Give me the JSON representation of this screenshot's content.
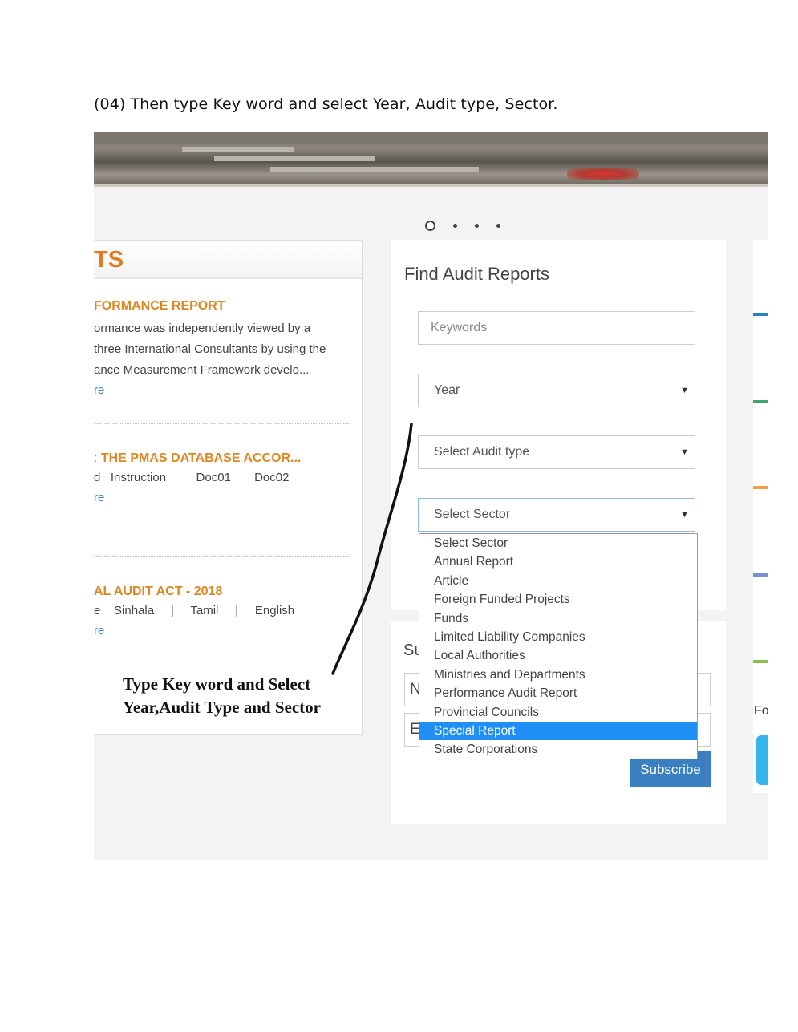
{
  "instruction": "(04) Then type Key word and select Year, Audit type, Sector.",
  "left_panel": {
    "title": "TS",
    "items": [
      {
        "title": "FORMANCE REPORT",
        "lines": [
          "ormance was independently viewed by a",
          "three International Consultants by using the",
          "ance Measurement Framework develo..."
        ],
        "more": "re"
      },
      {
        "title": "THE PMAS DATABASE ACCOR...",
        "line": "d   Instruction         Doc01       Doc02",
        "more": "re"
      },
      {
        "title": "AL AUDIT ACT - 2018",
        "line": "e    Sinhala     |     Tamil     |     English",
        "more": "re"
      }
    ],
    "annotation_line1": "Type Key word and Select",
    "annotation_line2": "Year,Audit Type and Sector"
  },
  "find": {
    "title": "Find Audit Reports",
    "keywords_placeholder": "Keywords",
    "year": "Year",
    "audit_type": "Select Audit type",
    "sector": "Select Sector",
    "sector_options": [
      "Select Sector",
      "Annual Report",
      "Article",
      "Foreign Funded Projects",
      "Funds",
      "Limited Liability Companies",
      "Local Authorities",
      "Ministries and Departments",
      "Performance Audit Report",
      "Provincial Councils",
      "Special Report",
      "State Corporations"
    ],
    "selected_option": "Special Report"
  },
  "subscribe": {
    "title": "Su",
    "name_field": "N",
    "email_field": "E",
    "button": "Subscribe"
  },
  "right": {
    "label": "Fo",
    "bar_colors": [
      "#2a7fc4",
      "#3aa86b",
      "#f0a040",
      "#7b8ed0",
      "#8bc34a"
    ]
  },
  "colors": {
    "accent_orange": "#e07d1e",
    "link_blue": "#3a86c8",
    "selected_blue": "#1f8ff5",
    "subscribe_blue": "#3a80c0"
  }
}
